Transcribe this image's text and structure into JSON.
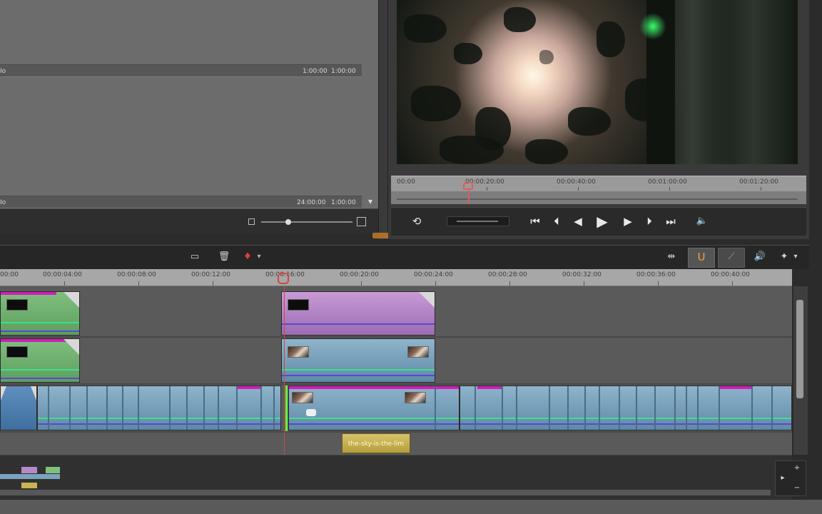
{
  "library": {
    "row_header_text": "Io",
    "row_header_btn1": "1:00:00",
    "row_header_btn2": "1:00:00",
    "footer_text": "Io",
    "footer_btn1": "24:00:00",
    "footer_btn2": "1:00:00",
    "scroll_down_glyph": "▼",
    "zoom_level": 0.3
  },
  "player": {
    "ruler_labels": [
      "00:00",
      "00:00:20:00",
      "00:00:40:00",
      "00:01:00:00",
      "00:01:20:00"
    ],
    "playhead_fraction": 0.18,
    "transport": {
      "loop": "⟲",
      "go_start": "⏮",
      "prev_frame": "⏴",
      "step_back": "◀",
      "play": "▶",
      "step_fwd": "▶",
      "next_frame": "⏵",
      "go_end": "⏭",
      "volume": "🔈"
    }
  },
  "timeline_toolbar": {
    "title_icon": "▭",
    "delete_icon": "🗑",
    "marker_icon": "♦",
    "dropdown_icon": "▾",
    "ripple_icon": "⇹",
    "magnet_icon": "U",
    "curve_icon": "⟋",
    "audio_icon": "🔊",
    "more_icon": "✦"
  },
  "timeline_ruler": {
    "labels": [
      "00:00",
      "00:00:04:00",
      "00:00:08:00",
      "00:00:12:00",
      "00:00:16:00",
      "00:00:20:00",
      "00:00:24:00",
      "00:00:28:00",
      "00:00:32:00",
      "00:00:36:00",
      "00:00:40:00"
    ]
  },
  "title_clip": {
    "label": "the-sky-is-the-lim"
  },
  "overview_controls": {
    "up": "+",
    "right": "▸",
    "down": "−"
  },
  "colors": {
    "accent": "#f2a23a",
    "playhead": "#d04646",
    "clip_green": "#6fb06f",
    "clip_purple": "#b482c6",
    "clip_blue": "#7aa2bc",
    "title_clip": "#c9b24f"
  }
}
